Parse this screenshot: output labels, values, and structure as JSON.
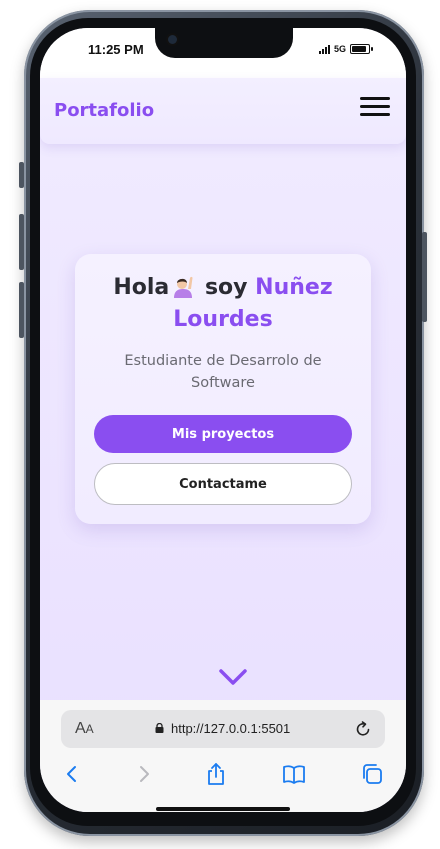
{
  "status": {
    "time": "11:25 PM",
    "network": "5G"
  },
  "navbar": {
    "brand": "Portafolio"
  },
  "hero": {
    "greeting_prefix": "Hola",
    "greeting_soy": "soy",
    "name_line1": "Nuñez",
    "name_line2": "Lourdes",
    "subtitle": "Estudiante de Desarrolo de Software",
    "primary_button": "Mis proyectos",
    "secondary_button": "Contactame"
  },
  "browser": {
    "aa_label_big": "A",
    "aa_label_small": "A",
    "url": "http://127.0.0.1:5501"
  },
  "colors": {
    "accent": "#8a4ef0",
    "background": "#efe8ff"
  },
  "icons": [
    "menu-icon",
    "person-raising-hand-emoji",
    "chevron-down-icon",
    "lock-icon",
    "reload-icon",
    "back-icon",
    "forward-icon",
    "share-icon",
    "bookmarks-icon",
    "tabs-icon"
  ]
}
